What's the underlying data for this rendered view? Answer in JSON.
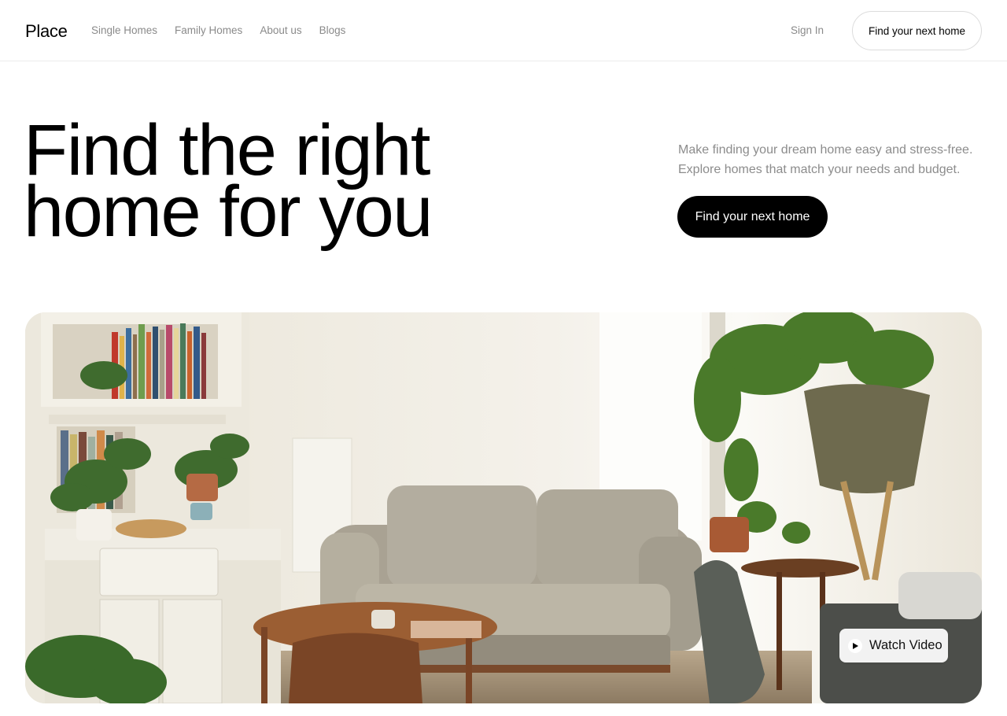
{
  "header": {
    "logo": "Place",
    "nav": [
      "Single Homes",
      "Family Homes",
      "About us",
      "Blogs"
    ],
    "sign_in": "Sign In",
    "cta": "Find your next home"
  },
  "hero": {
    "title_lines": [
      "Find the right",
      "home for you"
    ],
    "description_lines": [
      "Make finding your dream home easy and stress-free.",
      "Explore homes that match your needs and budget."
    ],
    "cta": "Find your next home"
  },
  "media": {
    "watch_video_label": "Watch Video",
    "play_icon": "play-icon"
  },
  "colors": {
    "text_primary": "#000000",
    "text_muted": "#8a8a8a",
    "button_dark": "#000000",
    "border": "#ececec"
  }
}
